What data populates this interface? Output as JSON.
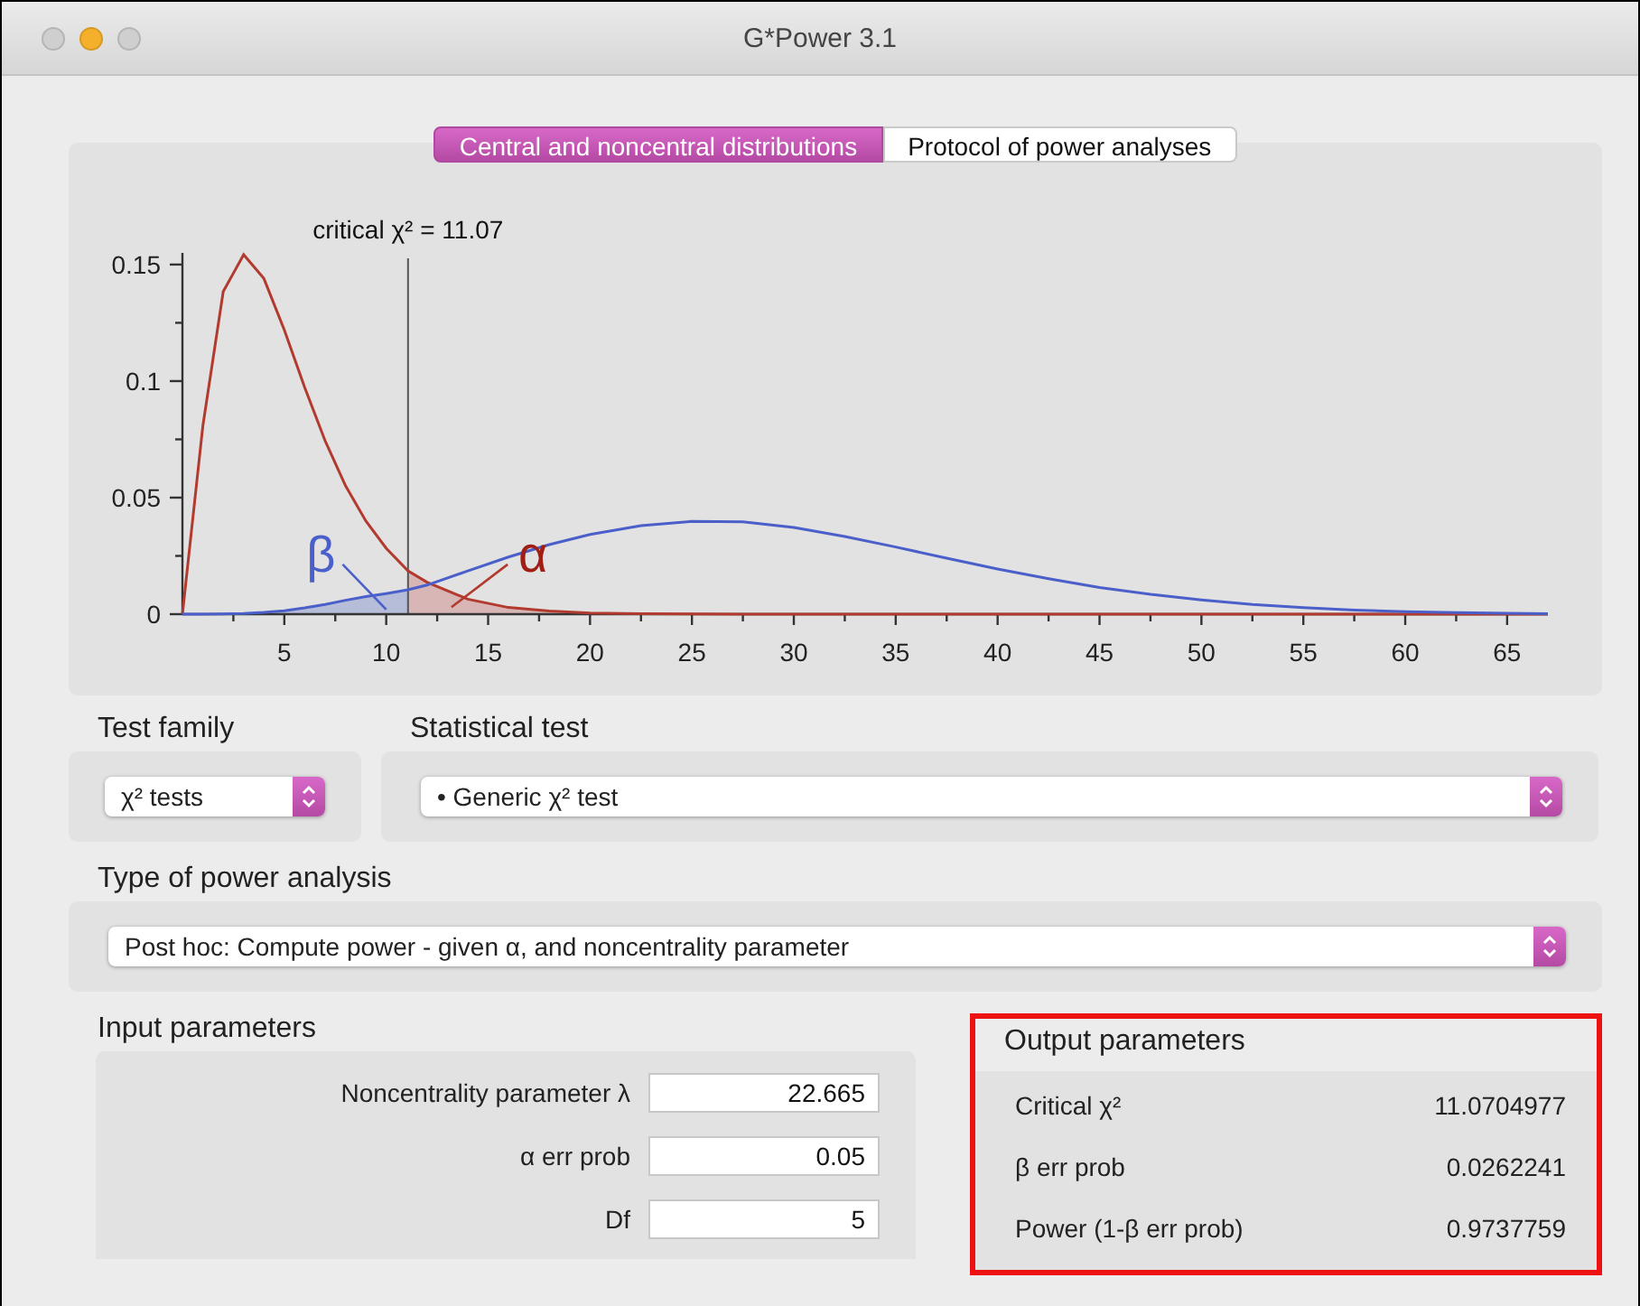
{
  "window": {
    "title": "G*Power 3.1",
    "buttons": [
      {
        "color": "#cfcfcf"
      },
      {
        "color": "#f4b02a"
      },
      {
        "color": "#cfcfcf"
      }
    ]
  },
  "tabs": [
    {
      "label": "Central and noncentral distributions",
      "selected": true
    },
    {
      "label": "Protocol of power analyses",
      "selected": false
    }
  ],
  "chart": {
    "chart_data": {
      "type": "line",
      "x": [
        0,
        1,
        2,
        3,
        4,
        5,
        6,
        7,
        8,
        9,
        10,
        11.07,
        12,
        14,
        16,
        18,
        20,
        22.5,
        25,
        27.5,
        30,
        32.5,
        35,
        37.5,
        40,
        42.5,
        45,
        47.5,
        50,
        52.5,
        55,
        57.5,
        60,
        62.5,
        65,
        67
      ],
      "series": [
        {
          "color": "#b23a2e",
          "values": [
            0,
            0.0807,
            0.1384,
            0.1542,
            0.144,
            0.122,
            0.0973,
            0.0744,
            0.0551,
            0.0399,
            0.0283,
            0.0186,
            0.0137,
            0.0064,
            0.0029,
            0.0013,
            0.0005,
            0.0002,
            0.0001,
            0,
            0,
            0,
            0,
            0,
            0,
            0,
            0,
            0,
            0,
            0,
            0,
            0,
            0,
            0,
            0,
            0
          ]
        },
        {
          "color": "#4a5fc9",
          "values": [
            0,
            0,
            0.0001,
            0.0003,
            0.0008,
            0.0015,
            0.0027,
            0.0042,
            0.006,
            0.0075,
            0.0088,
            0.0105,
            0.0125,
            0.0185,
            0.0245,
            0.0298,
            0.0342,
            0.038,
            0.0398,
            0.0396,
            0.0372,
            0.0333,
            0.0288,
            0.024,
            0.0194,
            0.0152,
            0.0115,
            0.0085,
            0.0061,
            0.0042,
            0.0028,
            0.0018,
            0.0011,
            0.0007,
            0.0004,
            0.0002
          ]
        }
      ],
      "xlim": [
        0,
        67
      ],
      "ylim": [
        0,
        0.155
      ],
      "xticks": [
        5,
        10,
        15,
        20,
        25,
        30,
        35,
        40,
        45,
        50,
        55,
        60,
        65
      ],
      "yticks": [
        0,
        0.05,
        0.1,
        0.15
      ],
      "ref_lines": [
        {
          "axis": "x",
          "value": 11.07,
          "label": "critical χ² = 11.07"
        }
      ],
      "annotations": [
        "β",
        "α"
      ]
    }
  },
  "test_family": {
    "label": "Test family",
    "value": "χ² tests"
  },
  "statistical_test": {
    "label": "Statistical test",
    "value": "• Generic χ² test"
  },
  "power_analysis": {
    "label": "Type of power analysis",
    "value": "Post hoc: Compute power - given α, and noncentrality parameter"
  },
  "input_parameters": {
    "title": "Input parameters",
    "fields": [
      {
        "label": "Noncentrality parameter λ",
        "value": "22.665"
      },
      {
        "label": "α err prob",
        "value": "0.05"
      },
      {
        "label": "Df",
        "value": "5"
      }
    ]
  },
  "output_parameters": {
    "title": "Output parameters",
    "highlighted": true,
    "rows": [
      {
        "label": "Critical χ²",
        "value": "11.0704977"
      },
      {
        "label": "β err prob",
        "value": "0.0262241"
      },
      {
        "label": "Power (1-β err prob)",
        "value": "0.9737759"
      }
    ]
  }
}
